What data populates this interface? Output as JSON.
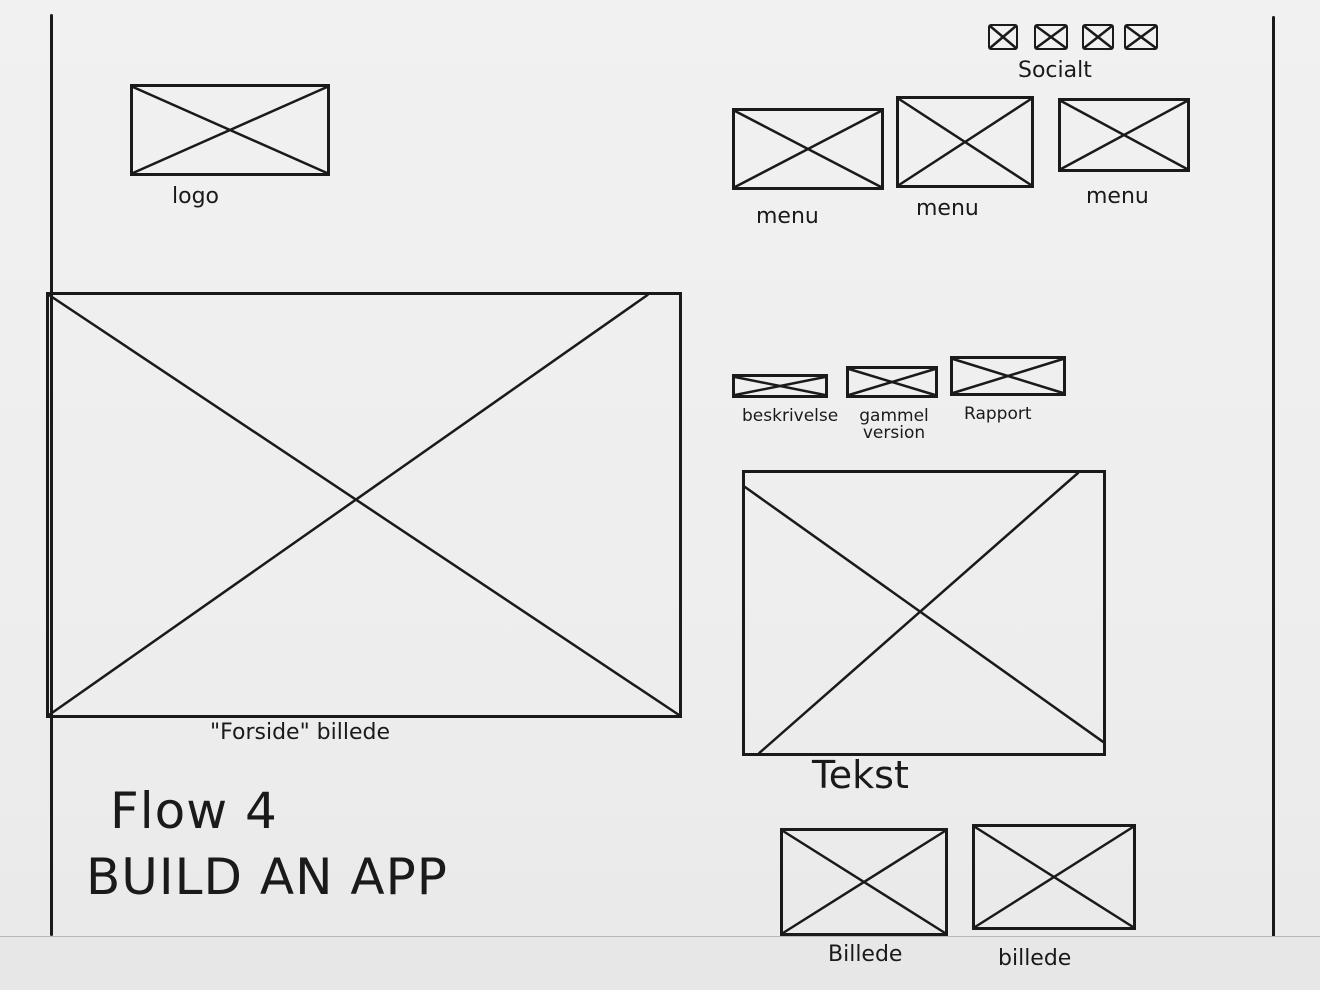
{
  "header": {
    "logo_label": "logo",
    "social_label": "Socialt",
    "menu_items": [
      {
        "label": "menu"
      },
      {
        "label": "menu"
      },
      {
        "label": "menu"
      }
    ]
  },
  "main": {
    "hero_caption": "\"Forside\" billede"
  },
  "sub_nav": {
    "items": [
      {
        "label": "beskrivelse"
      },
      {
        "label": "gammel version"
      },
      {
        "label": "Rapport"
      }
    ]
  },
  "content": {
    "text_label": "Tekst"
  },
  "gallery": {
    "items": [
      {
        "label": "Billede"
      },
      {
        "label": "billede"
      }
    ]
  },
  "title": {
    "line1": "Flow 4",
    "line2": "BUILD AN APP"
  }
}
